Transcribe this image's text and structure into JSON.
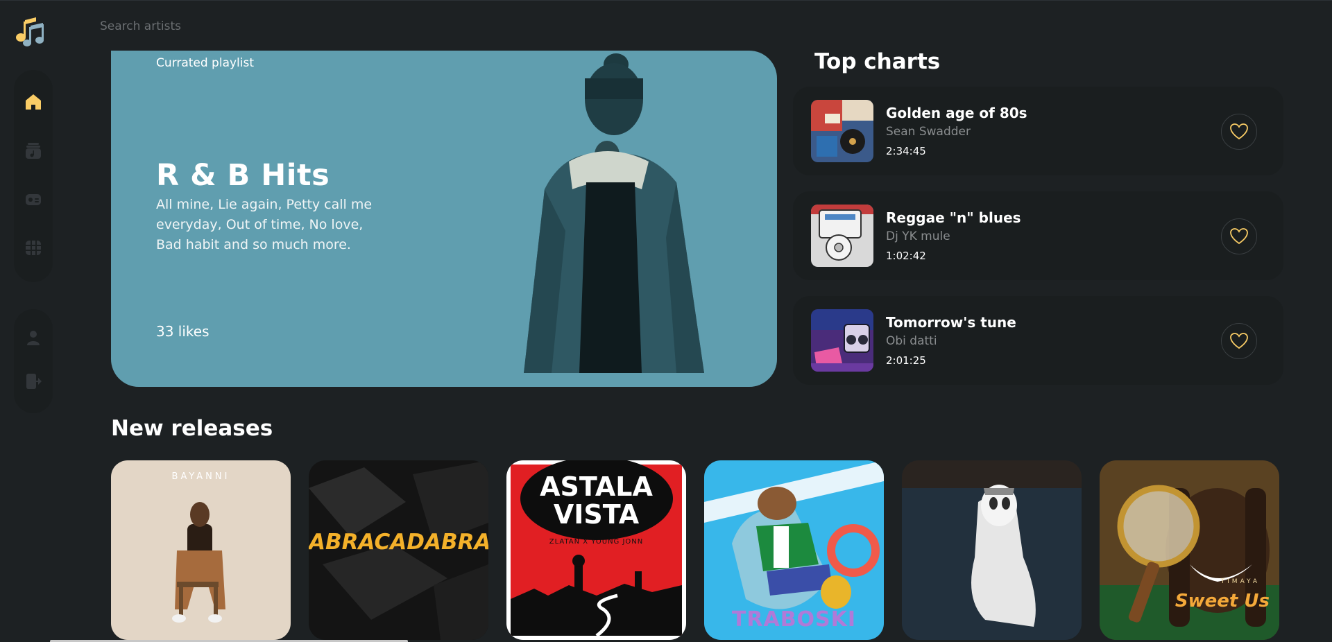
{
  "app": {
    "logo_icon": "music-notes-icon",
    "accent_color": "#facd66"
  },
  "sidebar": {
    "nav": [
      {
        "name": "home",
        "icon": "home-icon",
        "active": true
      },
      {
        "name": "playlist",
        "icon": "music-library-icon",
        "active": false
      },
      {
        "name": "radio",
        "icon": "radio-icon",
        "active": false
      },
      {
        "name": "videos",
        "icon": "video-icon",
        "active": false
      }
    ],
    "account": [
      {
        "name": "profile",
        "icon": "user-icon"
      },
      {
        "name": "logout",
        "icon": "logout-icon"
      }
    ]
  },
  "search": {
    "placeholder": "Search artists"
  },
  "hero": {
    "kicker": "Currated playlist",
    "title": "R & B Hits",
    "description": "All mine, Lie again, Petty call me everyday, Out of time, No love, Bad habit and so much more.",
    "likes": "33 likes",
    "background_color": "#609eaf"
  },
  "top_charts": {
    "heading": "Top charts",
    "items": [
      {
        "title": "Golden age of 80s",
        "artist": "Sean Swadder",
        "duration": "2:34:45"
      },
      {
        "title": "Reggae \"n\" blues",
        "artist": "Dj YK mule",
        "duration": "1:02:42"
      },
      {
        "title": "Tomorrow's tune",
        "artist": "Obi datti",
        "duration": "2:01:25"
      }
    ]
  },
  "new_releases": {
    "heading": "New releases",
    "items": [
      {
        "cover_text": "BAYANNI",
        "credits": ""
      },
      {
        "cover_text": "ABRACADABRA",
        "credits": ""
      },
      {
        "cover_text": "ASTALA VISTA",
        "credits": "ZLATAN  X  YOUNG JONN"
      },
      {
        "cover_text": "TRABOSKI",
        "credits": ""
      },
      {
        "cover_text": "",
        "credits": ""
      },
      {
        "cover_text": "TIMAYA",
        "credits": "Sweet Us"
      }
    ]
  }
}
